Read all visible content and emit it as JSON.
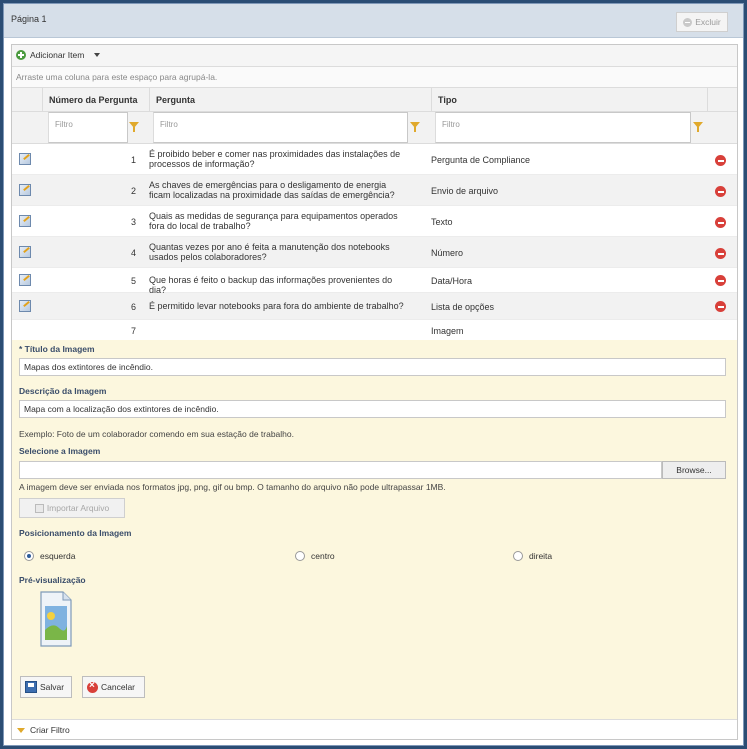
{
  "page": {
    "title": "Página 1",
    "delete_label": "Excluir"
  },
  "toolbar": {
    "add_item_label": "Adicionar Item"
  },
  "grid": {
    "group_hint": "Arraste uma coluna para este espaço para agrupá-la.",
    "columns": [
      "Número da Pergunta",
      "Pergunta",
      "Tipo"
    ],
    "filter_placeholder": "Filtro",
    "rows": [
      {
        "num": "1",
        "question": "É proibido beber e comer nas proximidades das instalações de processos de informação?",
        "type": "Pergunta de Compliance"
      },
      {
        "num": "2",
        "question": "As chaves de emergências para o desligamento de energia ficam localizadas na proximidade das saídas de emergência?",
        "type": "Envio de arquivo"
      },
      {
        "num": "3",
        "question": "Quais as medidas de segurança para equipamentos operados fora do local de trabalho?",
        "type": "Texto"
      },
      {
        "num": "4",
        "question": "Quantas vezes por ano é feita a manutenção dos notebooks usados pelos colaboradores?",
        "type": "Número"
      },
      {
        "num": "5",
        "question": "Que horas é feito o backup das informações provenientes do dia?",
        "type": "Data/Hora"
      },
      {
        "num": "6",
        "question": "É permitido levar notebooks para fora do ambiente de trabalho?",
        "type": "Lista de opções"
      }
    ],
    "new_row": {
      "num": "7",
      "type": "Imagem"
    }
  },
  "form": {
    "title_label": "* Título da Imagem",
    "title_value": "Mapas dos extintores de incêndio.",
    "desc_label": "Descrição da Imagem",
    "desc_value": "Mapa com a localização dos extintores de incêndio.",
    "example_text": "Exemplo: Foto de um colaborador comendo em sua estação de trabalho.",
    "select_label": "Selecione a Imagem",
    "browse_label": "Browse...",
    "file_hint": "A imagem deve ser enviada nos formatos jpg, png, gif ou bmp. O tamanho do arquivo não pode ultrapassar 1MB.",
    "import_label": "Importar Arquivo",
    "position_label": "Posicionamento da Imagem",
    "positions": [
      "esquerda",
      "centro",
      "direita"
    ],
    "selected_position": "esquerda",
    "preview_label": "Pré-visualização",
    "save_label": "Salvar",
    "cancel_label": "Cancelar"
  },
  "footer": {
    "create_filter_label": "Criar Filtro"
  }
}
